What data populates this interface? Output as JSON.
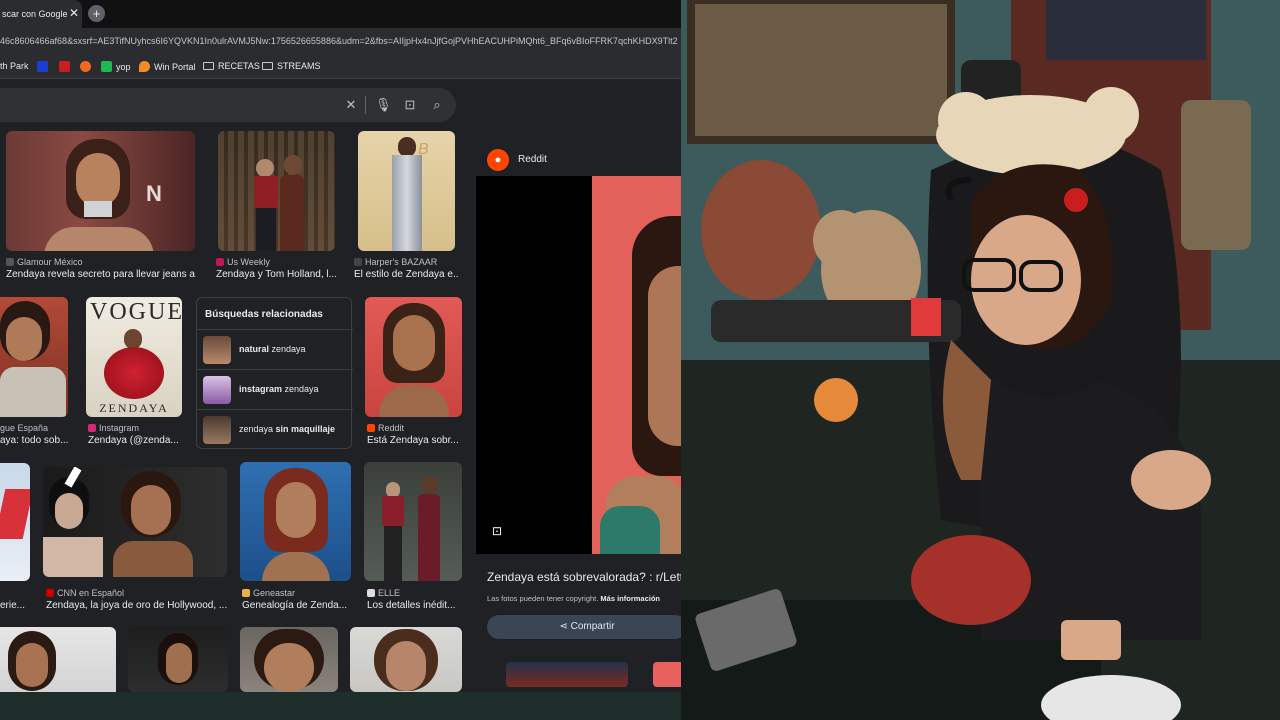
{
  "browser": {
    "tab_title": "scar con Google",
    "url": "46c8606466af68&sxsrf=AE3TifNUyhcs6I6YQVKN1In0ulrAVMJ5Nw:1756526655886&udm=2&fbs=AIIjpHx4nJjfGojPVHhEACUHPiMQht6_BFq6vBIoFFRK7qchKHDX9Tlt2",
    "bookmarks": [
      "th Park",
      "yop",
      "Win Portal",
      "RECETAS",
      "STREAMS"
    ]
  },
  "results": [
    {
      "source": "Glamour México",
      "caption": "Zendaya revela secreto para llevar jeans a..."
    },
    {
      "source": "Us Weekly",
      "caption": "Zendaya y Tom Holland, l..."
    },
    {
      "source": "Harper's BAZAAR",
      "caption": "El estilo de Zendaya e..."
    },
    {
      "source": "gue España",
      "caption": "aya: todo sob..."
    },
    {
      "source": "Instagram",
      "caption": "Zendaya (@zenda..."
    },
    {
      "source": "Reddit",
      "caption": "Está Zendaya sobr..."
    },
    {
      "source": "",
      "caption": "erie..."
    },
    {
      "source": "CNN en Español",
      "caption": "Zendaya, la joya de oro de Hollywood, ..."
    },
    {
      "source": "Geneastar",
      "caption": "Genealogía de Zenda..."
    },
    {
      "source": "ELLE",
      "caption": "Los detalles inédit..."
    }
  ],
  "related": {
    "title": "Búsquedas relacionadas",
    "items": [
      {
        "bold": "natural",
        "rest": " zendaya",
        "bold_first": true
      },
      {
        "bold": "instagram",
        "rest": " zendaya",
        "bold_first": true
      },
      {
        "bold": "sin maquillaje",
        "rest": "zendaya ",
        "bold_first": false
      }
    ]
  },
  "preview": {
    "site": "Reddit",
    "title": "Zendaya está sobrevalorada? : r/Lett",
    "copyright": "Las fotos pueden tener copyright.",
    "more_info": "Más información",
    "share": "Compartir"
  },
  "colors": {
    "accent_reddit": "#ff4500",
    "page_bg": "#202124"
  }
}
